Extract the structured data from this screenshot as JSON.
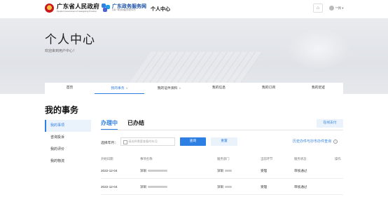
{
  "header": {
    "logo1": {
      "title": "广东省人民政府",
      "subtitle": "People's Government of Guangdong Province"
    },
    "logo2": {
      "title": "广东政务服务网",
      "subtitle": "互联一网式在线政务服务平台"
    },
    "center_title": "个人中心",
    "bell_glyph": "⌂",
    "user_name": "**佩 ▾"
  },
  "hero": {
    "title": "个人中心",
    "subtitle": "欢迎来到用户中心！"
  },
  "nav": {
    "items": [
      {
        "label": "首页"
      },
      {
        "label": "我的事务"
      },
      {
        "label": "我的证件资料"
      },
      {
        "label": "我的信息"
      },
      {
        "label": "我的订阅"
      },
      {
        "label": "我的足迹"
      }
    ],
    "dropdown_glyph": "∨"
  },
  "section_title": "我的事务",
  "sidebar": {
    "items": [
      {
        "label": "我的事项"
      },
      {
        "label": "咨询投诉"
      },
      {
        "label": "我的评价"
      },
      {
        "label": "我的物流"
      }
    ]
  },
  "tabs": [
    {
      "label": "办理中"
    },
    {
      "label": "已办结"
    }
  ],
  "online_button": "在线支付",
  "filter": {
    "label": "选择年月：",
    "placeholder": "请选择需要查看的年月",
    "search_button": "查询",
    "reset_button": "重置",
    "history_link": "历史办件与抄市办件查询",
    "info_glyph": "i"
  },
  "table": {
    "headers": [
      "开始日期",
      "事项名称",
      "服务部门",
      "当前环节",
      "服务状态",
      "操作"
    ],
    "rows": [
      {
        "date": "2022-12-04",
        "name": "深圳",
        "dept": "深圳",
        "stage": "受理",
        "status": "审核通过"
      },
      {
        "date": "2022-12-04",
        "name": "深圳",
        "dept": "深圳",
        "stage": "受理",
        "status": "审核通过"
      }
    ]
  }
}
